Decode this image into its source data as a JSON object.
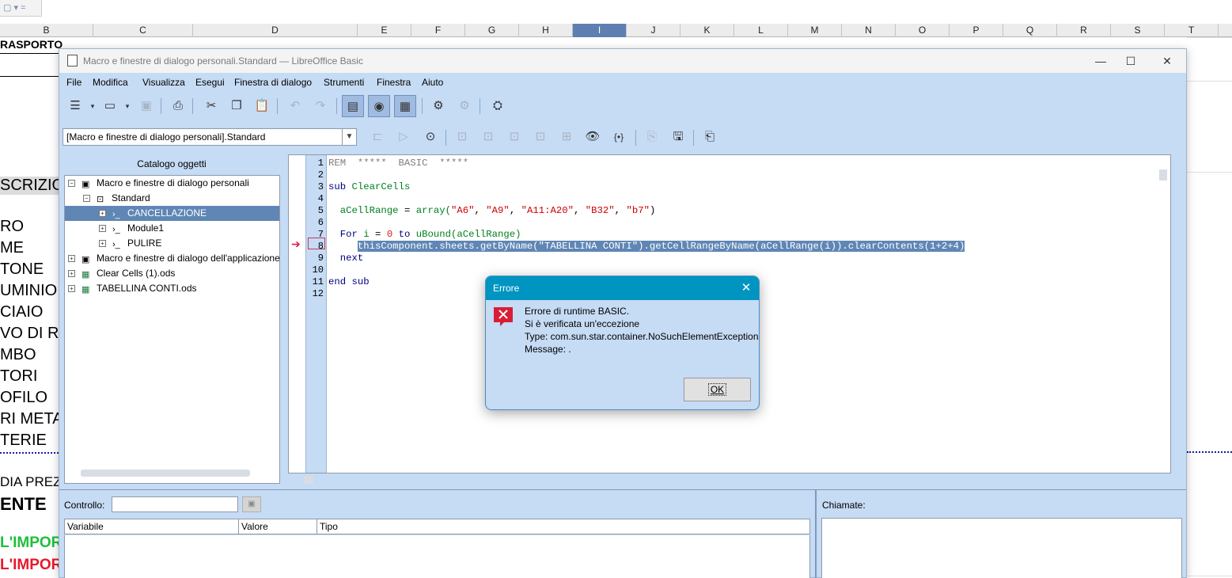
{
  "sheet": {
    "columns": [
      "B",
      "C",
      "D",
      "E",
      "F",
      "G",
      "H",
      "I",
      "J",
      "K",
      "L",
      "M",
      "N",
      "O",
      "P",
      "Q",
      "R",
      "S",
      "T"
    ],
    "selected_column": "I",
    "cells": [
      "RASPORTO:",
      "SCRIZIO",
      "RO",
      "ME",
      "TONE",
      "UMINIO",
      "CIAIO",
      "VO DI RA",
      "MBO",
      "TORI",
      "OFILO",
      "RI META",
      "TERIE",
      "DIA PREZ",
      "ENTE",
      "L'IMPOR",
      "L'IMPOR"
    ]
  },
  "window": {
    "title": "Macro e finestre di dialogo personali.Standard — LibreOffice Basic",
    "minimize": "—",
    "maximize": "☐",
    "close": "✕"
  },
  "menu": [
    "File",
    "Modifica",
    "Visualizza",
    "Esegui",
    "Finestra di dialogo",
    "Strumenti",
    "Finestra",
    "Aiuto"
  ],
  "library_selector": {
    "value": "[Macro e finestre di dialogo personali].Standard"
  },
  "catalog": {
    "title": "Catalogo oggetti",
    "items": [
      {
        "label": "Macro e finestre di dialogo personali",
        "expander": "−",
        "icon": "library-icon"
      },
      {
        "label": "Standard",
        "expander": "−",
        "icon": "basic-library-icon"
      },
      {
        "label": "CANCELLAZIONE",
        "expander": "+",
        "icon": "module-icon"
      },
      {
        "label": "Module1",
        "expander": "+",
        "icon": "module-icon"
      },
      {
        "label": "PULIRE",
        "expander": "+",
        "icon": "module-icon"
      },
      {
        "label": "Macro e finestre di dialogo dell'applicazione",
        "expander": "+",
        "icon": "library-icon"
      },
      {
        "label": "Clear Cells (1).ods",
        "expander": "+",
        "icon": "spreadsheet-icon"
      },
      {
        "label": "TABELLINA CONTI.ods",
        "expander": "+",
        "icon": "spreadsheet-icon"
      }
    ],
    "selected": "CANCELLAZIONE"
  },
  "editor": {
    "line_numbers": [
      "1",
      "2",
      "3",
      "4",
      "5",
      "6",
      "7",
      "8",
      "9",
      "10",
      "11",
      "12"
    ],
    "current_line": "8",
    "code": {
      "l1": "REM  *****  BASIC  *****",
      "l3_kw": "sub ",
      "l3_id": "ClearCells",
      "l5_a": "  aCellRange ",
      "l5_b": "= ",
      "l5_c": "array(",
      "l5_s1": "\"A6\"",
      "l5_s2": "\"A9\"",
      "l5_s3": "\"A11:A20\"",
      "l5_s4": "\"B32\"",
      "l5_s5": "\"b7\"",
      "l7_for": "  For ",
      "l7_i": "i ",
      "l7_eq": "= ",
      "l7_0": "0",
      "l7_to": " to ",
      "l7_ub": "uBound(aCellRange)",
      "l8_indent": "     ",
      "l8": "thisComponent.sheets.getByName(\"TABELLINA CONTI\").getCellRangeByName(aCellRange(i)).clearContents(1+2+4)",
      "l9": "  next",
      "l11": "end sub"
    }
  },
  "watch": {
    "label": "Controllo:",
    "input_value": "",
    "columns": [
      "Variabile",
      "Valore",
      "Tipo"
    ]
  },
  "calls": {
    "label": "Chiamate:"
  },
  "dialog": {
    "title": "Errore",
    "close": "✕",
    "lines": [
      "Errore di runtime BASIC.",
      "Si è verificata un'eccezione",
      "Type: com.sun.star.container.NoSuchElementException",
      "Message: ."
    ],
    "ok_label": "OK"
  },
  "colors": {
    "ide_background": "#c6dbf4",
    "dialog_titlebar": "#0095c1",
    "selection": "#5f86b5",
    "error_icon": "#d81e36"
  }
}
